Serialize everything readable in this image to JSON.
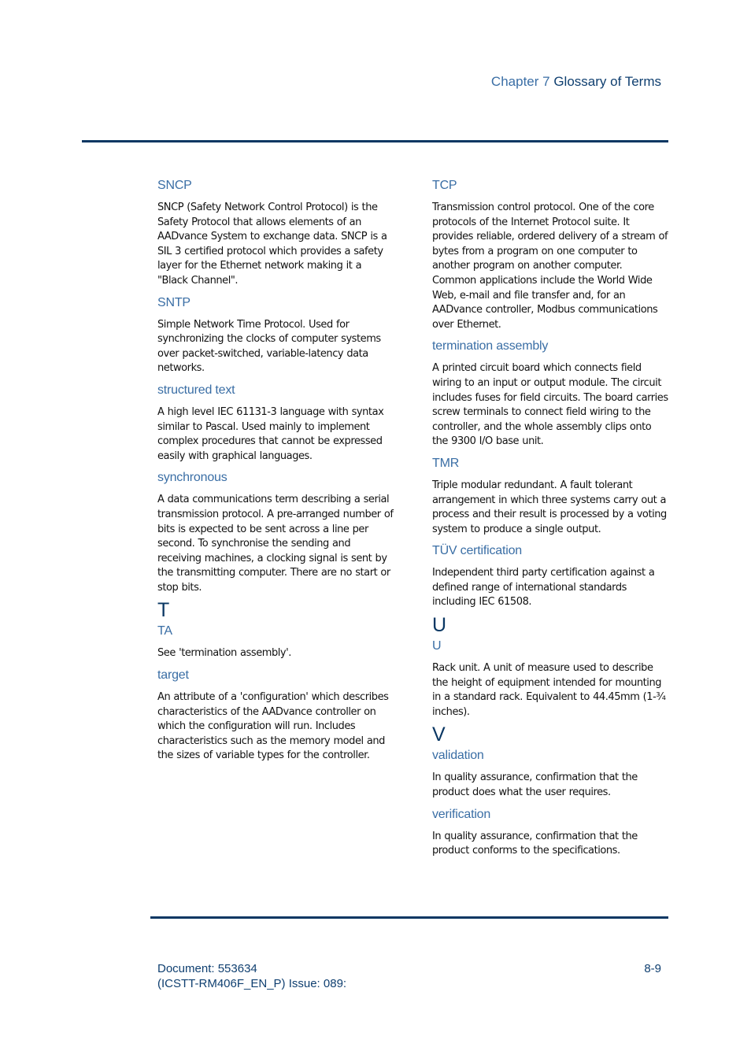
{
  "header": {
    "chapter_label": "Chapter 7",
    "chapter_title": "Glossary of Terms"
  },
  "colors": {
    "term_heading": "#3a6ea5",
    "section_letter": "#0a3763",
    "rule": "#0a3763"
  },
  "left_column": {
    "entries": [
      {
        "term": "SNCP",
        "definition": "SNCP (Safety Network Control Protocol) is the Safety Protocol that allows elements of an AADvance System to exchange data. SNCP is a SIL 3 certified protocol which provides a safety layer for the Ethernet network making it a \"Black Channel\"."
      },
      {
        "term": "SNTP",
        "definition": "Simple Network Time Protocol. Used for synchronizing the clocks of computer systems over packet-switched, variable-latency data networks."
      },
      {
        "term": "structured text",
        "definition": "A high level IEC 61131-3 language with syntax similar to Pascal. Used mainly to implement complex procedures that cannot be expressed easily with graphical languages."
      },
      {
        "term": "synchronous",
        "definition": "A data communications term describing a serial transmission protocol. A pre-arranged number of bits is expected to be sent across a line per second. To synchronise the sending and receiving machines, a clocking signal is sent by the transmitting computer. There are no start or stop bits."
      }
    ],
    "section_t": {
      "letter": "T",
      "entries": [
        {
          "term": "TA",
          "definition": "See 'termination assembly'."
        },
        {
          "term": "target",
          "definition": "An attribute of a 'configuration' which describes characteristics of the AADvance controller on which the configuration will run. Includes characteristics such as the memory model and the sizes of variable types for the controller."
        }
      ]
    }
  },
  "right_column": {
    "entries": [
      {
        "term": "TCP",
        "definition": "Transmission control protocol. One of the core protocols of the Internet Protocol suite. It provides reliable, ordered delivery of a stream of bytes from a program on one computer to another program on another computer. Common applications include the World Wide Web, e-mail and file transfer and, for an AADvance controller, Modbus communications over Ethernet."
      },
      {
        "term": "termination assembly",
        "definition": "A printed circuit board which connects field wiring to an input or output module. The circuit includes fuses for field circuits. The board carries screw terminals to connect field wiring to the controller, and the whole assembly clips onto the 9300 I/O base unit."
      },
      {
        "term": "TMR",
        "definition": "Triple modular redundant. A fault tolerant arrangement in which three systems carry out a process and their result is processed by a voting system to produce a single output."
      },
      {
        "term": "TÜV certification",
        "definition": "Independent third party certification against a defined range of international standards including IEC 61508."
      }
    ],
    "section_u": {
      "letter": "U",
      "entries": [
        {
          "term": "U",
          "definition": "Rack unit. A unit of measure used to describe the height of equipment intended for mounting in a standard rack. Equivalent to 44.45mm (1-¾ inches)."
        }
      ]
    },
    "section_v": {
      "letter": "V",
      "entries": [
        {
          "term": "validation",
          "definition": "In quality assurance, confirmation that the product does what the user requires."
        },
        {
          "term": "verification",
          "definition": "In quality assurance, confirmation that the product conforms to the specifications."
        }
      ]
    }
  },
  "footer": {
    "document_line": "Document: 553634",
    "issue_line": "(ICSTT-RM406F_EN_P) Issue: 089:",
    "page_number": "8-9"
  }
}
